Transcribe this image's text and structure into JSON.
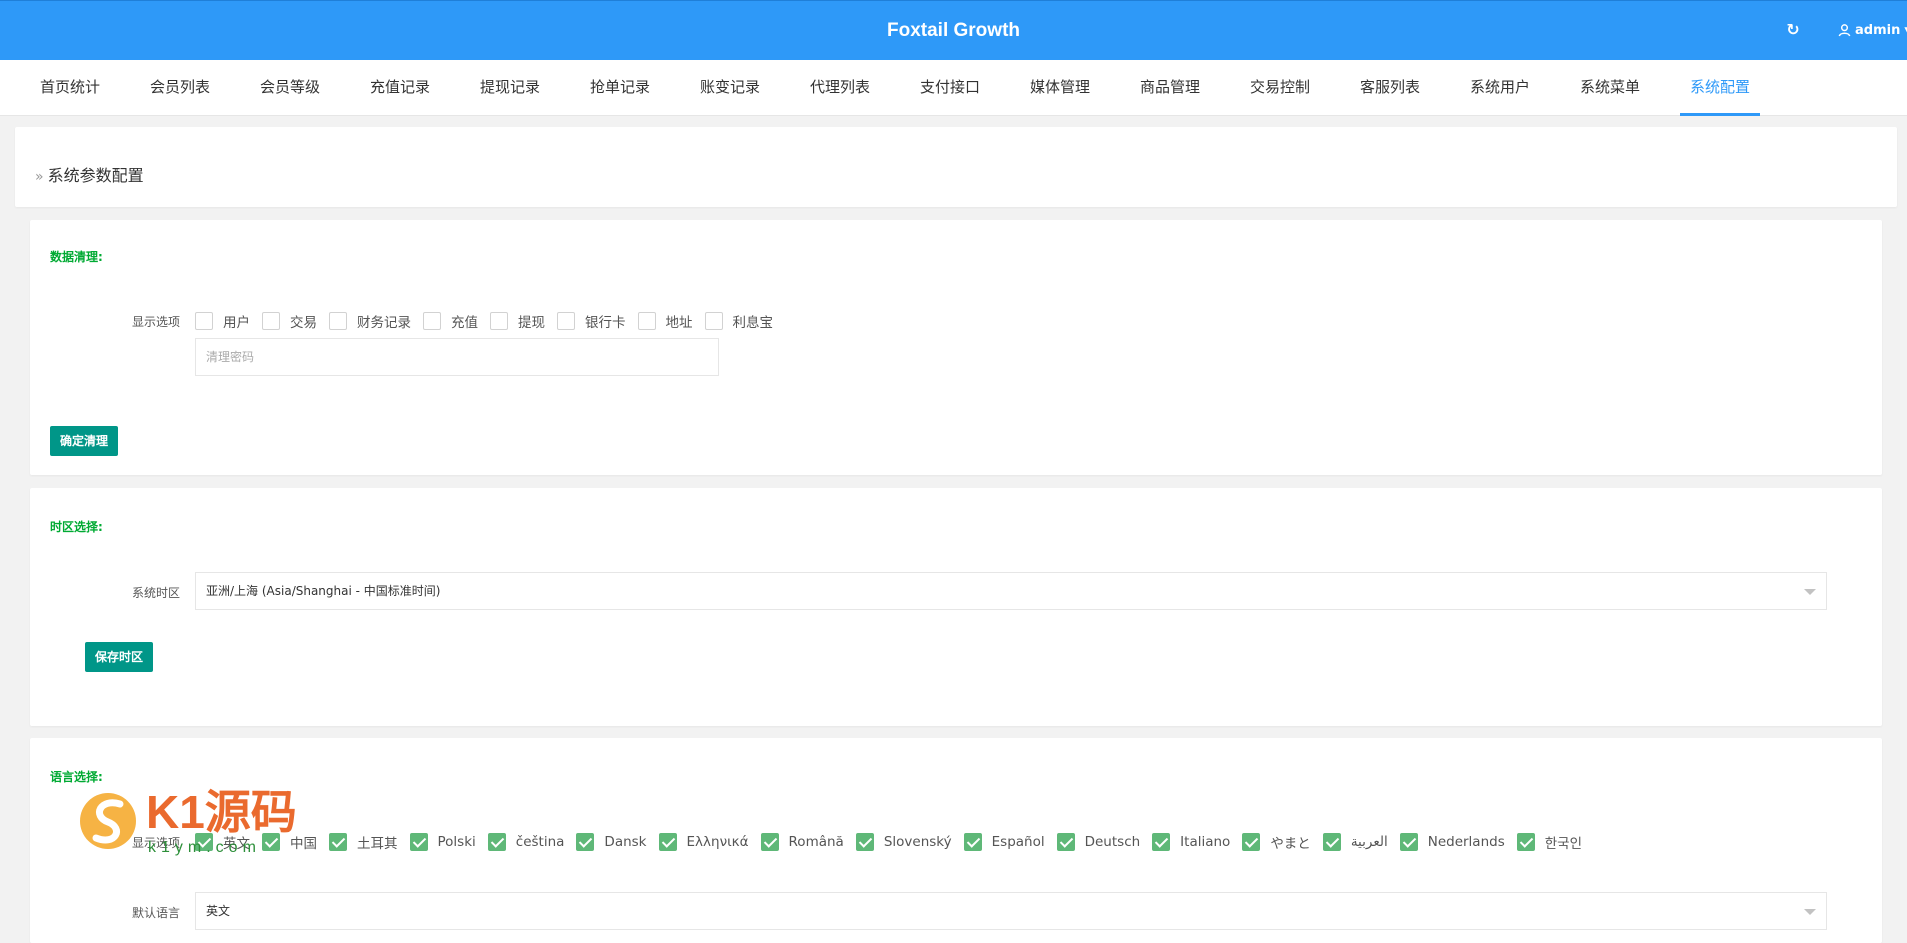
{
  "app": {
    "title": "Foxtail Growth",
    "user": "admin"
  },
  "nav": {
    "items": [
      "首页统计",
      "会员列表",
      "会员等级",
      "充值记录",
      "提现记录",
      "抢单记录",
      "账变记录",
      "代理列表",
      "支付接口",
      "媒体管理",
      "商品管理",
      "交易控制",
      "客服列表",
      "系统用户",
      "系统菜单",
      "系统配置"
    ],
    "active_index": 15
  },
  "page": {
    "title": "系统参数配置"
  },
  "data_clean": {
    "title": "数据清理:",
    "options_label": "显示选项",
    "options": [
      {
        "label": "用户",
        "checked": false
      },
      {
        "label": "交易",
        "checked": false
      },
      {
        "label": "财务记录",
        "checked": false
      },
      {
        "label": "充值",
        "checked": false
      },
      {
        "label": "提现",
        "checked": false
      },
      {
        "label": "银行卡",
        "checked": false
      },
      {
        "label": "地址",
        "checked": false
      },
      {
        "label": "利息宝",
        "checked": false
      }
    ],
    "password_placeholder": "清理密码",
    "button": "确定清理"
  },
  "timezone": {
    "title": "时区选择:",
    "label": "系统时区",
    "value": "亚洲/上海 (Asia/Shanghai - 中国标准时间)",
    "button": "保存时区"
  },
  "language": {
    "title": "语言选择:",
    "options_label": "显示选项",
    "options": [
      {
        "label": "英文",
        "checked": true
      },
      {
        "label": "中国",
        "checked": true
      },
      {
        "label": "土耳其",
        "checked": true
      },
      {
        "label": "Polski",
        "checked": true
      },
      {
        "label": "čeština",
        "checked": true
      },
      {
        "label": "Dansk",
        "checked": true
      },
      {
        "label": "Ελληνικά",
        "checked": true
      },
      {
        "label": "Română",
        "checked": true
      },
      {
        "label": "Slovenský",
        "checked": true
      },
      {
        "label": "Español",
        "checked": true
      },
      {
        "label": "Deutsch",
        "checked": true
      },
      {
        "label": "Italiano",
        "checked": true
      },
      {
        "label": "やまと",
        "checked": true
      },
      {
        "label": "العربية",
        "checked": true
      },
      {
        "label": "Nederlands",
        "checked": true
      },
      {
        "label": "한국인",
        "checked": true
      }
    ],
    "default_label": "默认语言",
    "default_value": "英文"
  },
  "watermark": {
    "text": "K1源码",
    "sub": "k1ym.com"
  },
  "colors": {
    "header": "#2e99f8",
    "accent": "#2e99f8",
    "section_title": "#00aa33",
    "button": "#009688",
    "checked": "#5fb878"
  }
}
